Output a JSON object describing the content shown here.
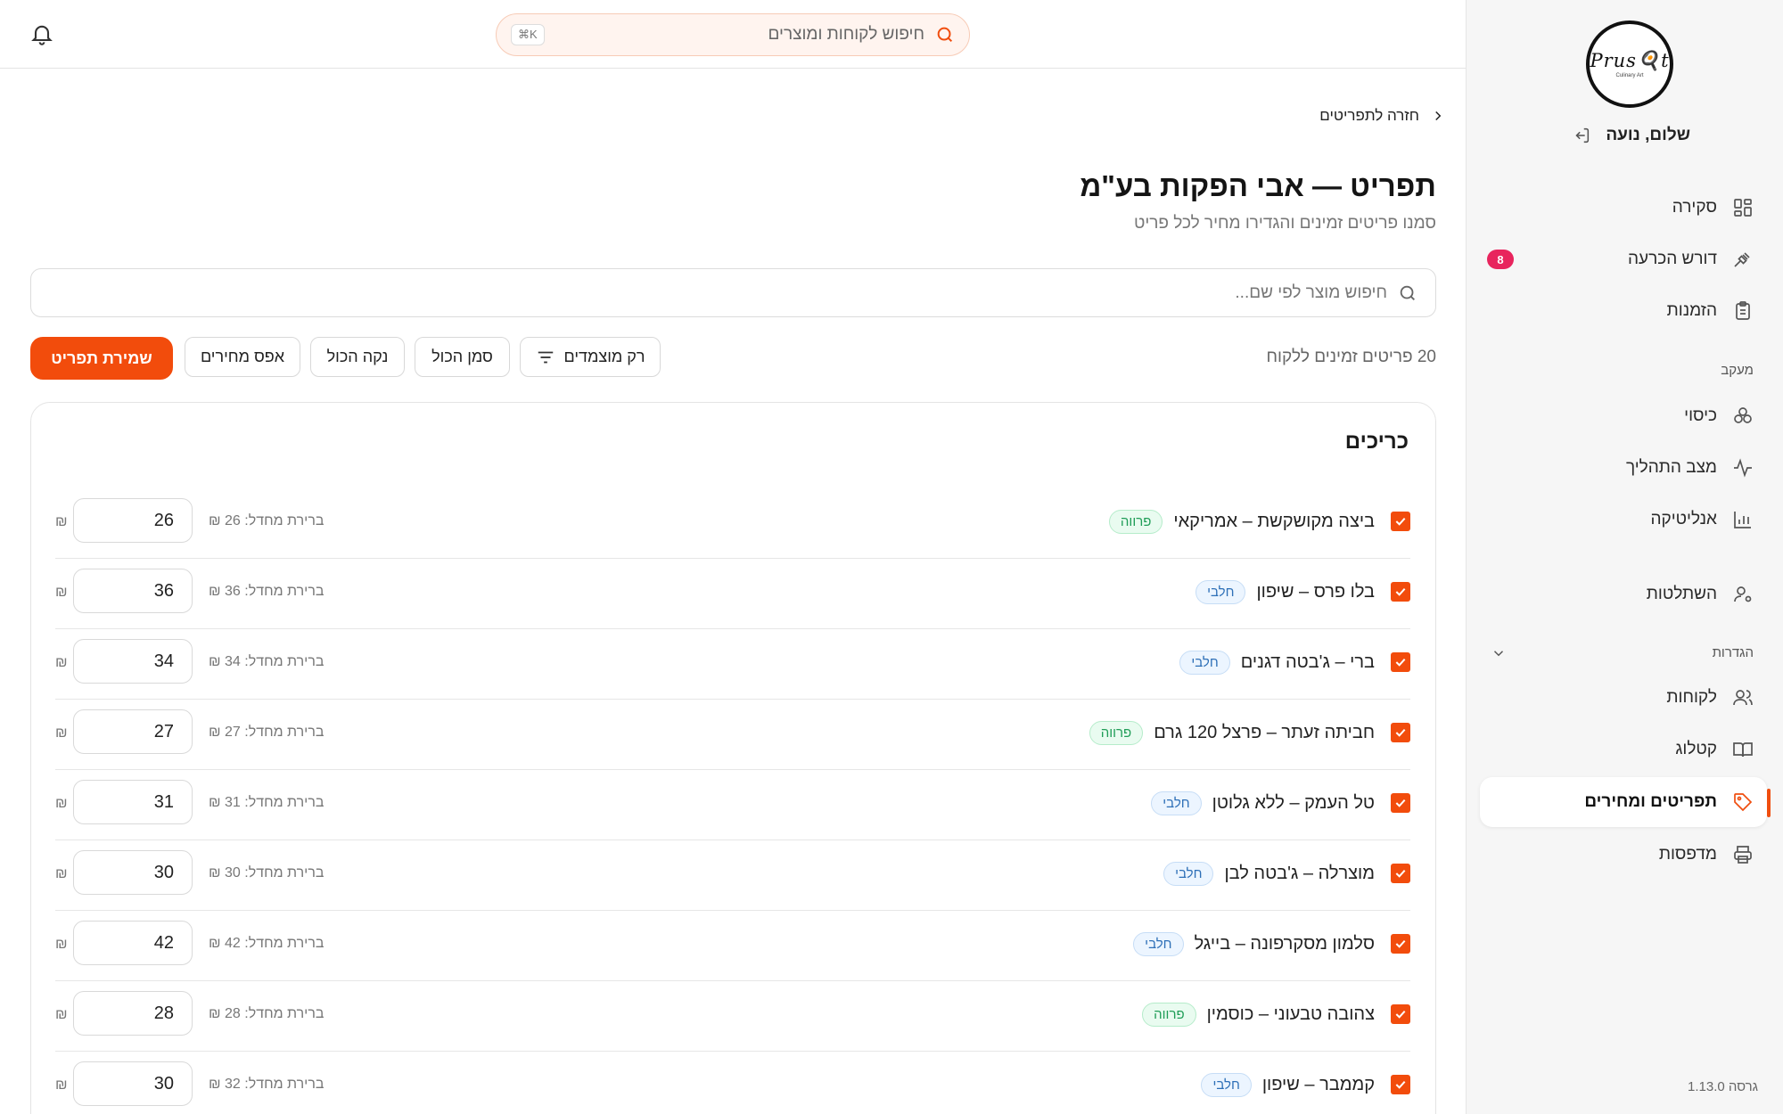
{
  "sidebar": {
    "logo_text": "Prus🍳t",
    "logo_subtext": "Culinary Art",
    "greeting": "שלום, נועה",
    "items": [
      {
        "label": "סקירה",
        "icon": "grid-icon"
      },
      {
        "label": "דורש הכרעה",
        "icon": "gavel-icon",
        "badge": "8"
      },
      {
        "label": "הזמנות",
        "icon": "clipboard-icon"
      },
      {
        "label": "כיסוי",
        "icon": "boxes-icon"
      },
      {
        "label": "מצב התהליך",
        "icon": "activity-icon"
      },
      {
        "label": "אנליטיקה",
        "icon": "bar-chart-icon"
      },
      {
        "label": "השתלטות",
        "icon": "user-gear-icon"
      },
      {
        "label": "לקוחות",
        "icon": "users-icon"
      },
      {
        "label": "קטלוג",
        "icon": "book-icon"
      },
      {
        "label": "תפריטים ומחירים",
        "icon": "tag-icon",
        "active": true
      },
      {
        "label": "מדפסות",
        "icon": "printer-icon"
      }
    ],
    "section_tracking": "מעקב",
    "section_settings": "הגדרות",
    "version": "גרסה 1.13.0"
  },
  "topbar": {
    "search_placeholder": "חיפוש לקוחות ומוצרים",
    "shortcut": "⌘K"
  },
  "main": {
    "back_label": "חזרה לתפריטים",
    "title": "תפריט — אבי הפקות בע\"מ",
    "subtitle": "סמנו פריטים זמינים והגדירו מחיר לכל פריט",
    "product_search_placeholder": "חיפוש מוצר לפי שם...",
    "available_count": "20 פריטים זמינים ללקוח",
    "buttons": {
      "featured_only": "רק מוצמדים",
      "select_all": "סמן הכול",
      "clear_all": "נקה הכול",
      "reset_prices": "אפס מחירים",
      "save_menu": "שמירת תפריט"
    },
    "section_title": "כריכים",
    "currency": "₪",
    "products": [
      {
        "name": "ביצה מקושקשת – אמריקאי",
        "tag": "פרווה",
        "tag_color": "green",
        "default_price": "ברירת מחדל: 26 ₪",
        "price": "26"
      },
      {
        "name": "בלו פרס – שיפון",
        "tag": "חלבי",
        "tag_color": "blue",
        "default_price": "ברירת מחדל: 36 ₪",
        "price": "36"
      },
      {
        "name": "ברי – ג'בטה דגנים",
        "tag": "חלבי",
        "tag_color": "blue",
        "default_price": "ברירת מחדל: 34 ₪",
        "price": "34"
      },
      {
        "name": "חביתה זעתר – פרצל 120 גרם",
        "tag": "פרווה",
        "tag_color": "green",
        "default_price": "ברירת מחדל: 27 ₪",
        "price": "27"
      },
      {
        "name": "טל העמק – ללא גלוטן",
        "tag": "חלבי",
        "tag_color": "blue",
        "default_price": "ברירת מחדל: 31 ₪",
        "price": "31"
      },
      {
        "name": "מוצרלה – ג'בטה לבן",
        "tag": "חלבי",
        "tag_color": "blue",
        "default_price": "ברירת מחדל: 30 ₪",
        "price": "30"
      },
      {
        "name": "סלמון מסקרפונה – בייגל",
        "tag": "חלבי",
        "tag_color": "blue",
        "default_price": "ברירת מחדל: 42 ₪",
        "price": "42"
      },
      {
        "name": "צהובה טבעוני – כוסמין",
        "tag": "פרווה",
        "tag_color": "green",
        "default_price": "ברירת מחדל: 28 ₪",
        "price": "28"
      },
      {
        "name": "קממבר – שיפון",
        "tag": "חלבי",
        "tag_color": "blue",
        "default_price": "ברירת מחדל: 32 ₪",
        "price": "30"
      }
    ]
  },
  "colors": {
    "accent": "#f24c0c",
    "badge": "#e8245d",
    "tag_green": "#1f9d57",
    "tag_blue": "#2d6fb7"
  }
}
